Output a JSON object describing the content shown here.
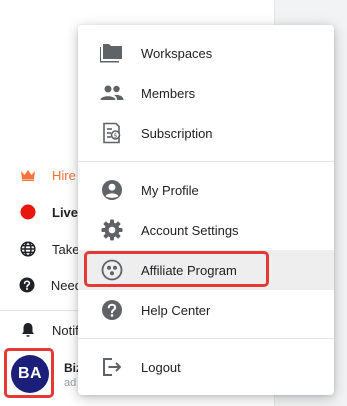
{
  "sidebar": {
    "items": [
      {
        "label": "Hire",
        "icon": "crown-icon"
      },
      {
        "label": "Live",
        "icon": "live-dot-icon"
      },
      {
        "label": "Take",
        "icon": "globe-icon"
      },
      {
        "label": "Need",
        "icon": "help-circle-icon"
      },
      {
        "label": "Notif",
        "icon": "bell-icon"
      }
    ],
    "user": {
      "initials": "BA",
      "name": "Biz",
      "subtitle": "ad"
    }
  },
  "menu": {
    "items": [
      {
        "label": "Workspaces",
        "icon": "folders-icon"
      },
      {
        "label": "Members",
        "icon": "people-icon"
      },
      {
        "label": "Subscription",
        "icon": "invoice-dollar-icon"
      },
      {
        "label": "My Profile",
        "icon": "account-circle-icon"
      },
      {
        "label": "Account Settings",
        "icon": "gear-icon"
      },
      {
        "label": "Affiliate Program",
        "icon": "affiliate-icon"
      },
      {
        "label": "Help Center",
        "icon": "help-circle-icon"
      },
      {
        "label": "Logout",
        "icon": "logout-icon"
      }
    ],
    "selected": "Affiliate Program"
  },
  "colors": {
    "accent_orange": "#f4733a",
    "live_red": "#e8160c",
    "avatar_navy": "#1c1f7a",
    "highlight_red": "#e53935",
    "icon_gray": "#5f6368"
  }
}
